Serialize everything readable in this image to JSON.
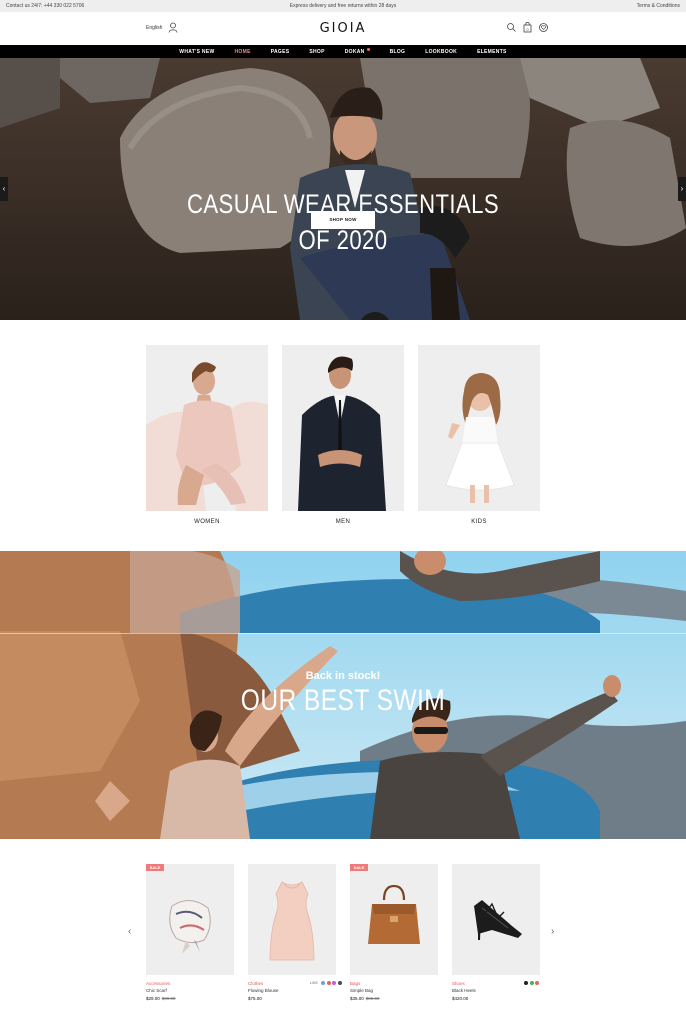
{
  "topbar": {
    "contact": "Contact us 24/7: +44 330 022 5706",
    "promo": "Express delivery and free returns within 28 days",
    "terms": "Terms & Conditions"
  },
  "header": {
    "language": "English",
    "logo": "GIOIA",
    "icons": [
      "search-icon",
      "cart-icon",
      "wishlist-icon"
    ],
    "cart_count": "0"
  },
  "nav": {
    "items": [
      {
        "label": "WHAT'S NEW",
        "active": false
      },
      {
        "label": "HOME",
        "active": true
      },
      {
        "label": "PAGES",
        "active": false
      },
      {
        "label": "SHOP",
        "active": false
      },
      {
        "label": "DOKAN",
        "active": false
      },
      {
        "label": "BLOG",
        "active": false
      },
      {
        "label": "LOOKBOOK",
        "active": false
      },
      {
        "label": "ELEMENTS",
        "active": false
      }
    ]
  },
  "hero": {
    "title_line1": "CASUAL WEAR ESSENTIALS",
    "title_line2": "OF 2020",
    "button": "SHOP NOW"
  },
  "categories": [
    {
      "label": "WOMEN"
    },
    {
      "label": "MEN"
    },
    {
      "label": "KIDS"
    }
  ],
  "banner": {
    "subtitle": "Back in stock!",
    "title": "OUR BEST SWIM"
  },
  "products": [
    {
      "category": "Accessories",
      "name": "Chic Scarf",
      "price": "$29.00",
      "old_price": "$39.00",
      "sale": "SALE"
    },
    {
      "category": "Clothes",
      "name": "Flowing Blouse",
      "price": "$75.00",
      "sizes": "L/XS",
      "swatches": [
        "#6aa0e6",
        "#e46363",
        "#c35ce0",
        "#4b4b4b"
      ]
    },
    {
      "category": "Bags",
      "name": "Simple Bag",
      "price": "$35.00",
      "old_price": "$85.00",
      "sale": "SALE"
    },
    {
      "category": "Shoes",
      "name": "Black Heels",
      "price": "$420.00",
      "swatches": [
        "#222222",
        "#4caf50",
        "#e46363"
      ]
    }
  ],
  "colors": {
    "accent": "#ee7b7b",
    "nav_bg": "#000000",
    "active_nav": "#f08a8a"
  }
}
